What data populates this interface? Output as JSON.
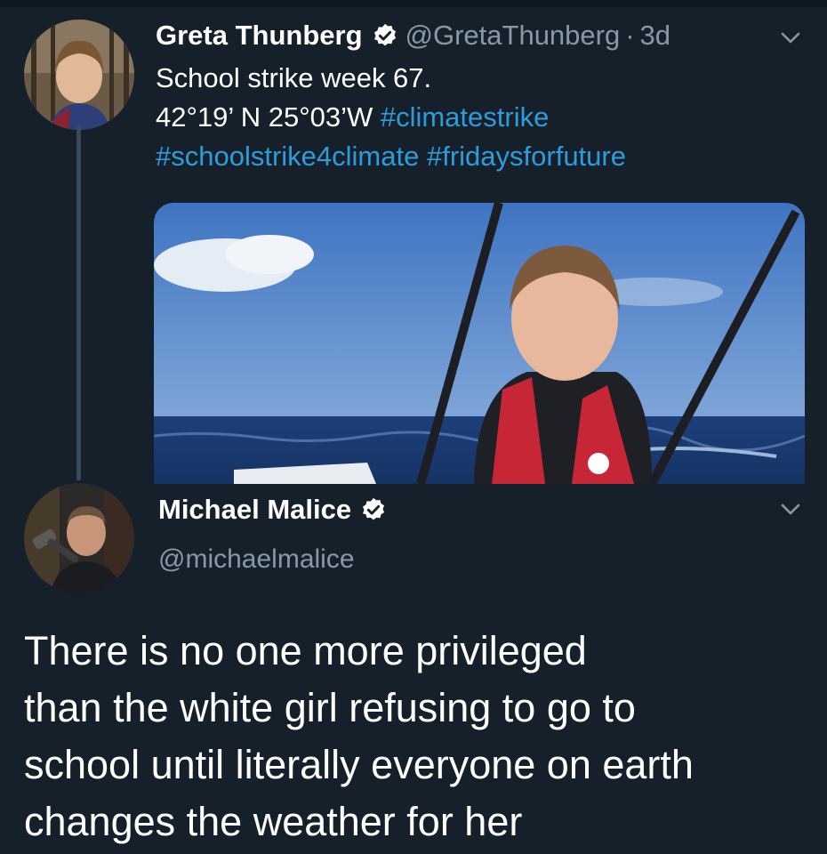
{
  "original_tweet": {
    "display_name": "Greta Thunberg",
    "handle": "@GretaThunberg",
    "separator": "·",
    "timestamp": "3d",
    "text_lines": [
      "School strike week 67.",
      "42°19’ N 25°03’W"
    ],
    "hashtags": {
      "climatestrike": "#climatestrike",
      "schoolstrike4climate": "#schoolstrike4climate",
      "fridaysforfuture": "#fridaysforfuture"
    },
    "media": {
      "description_icon": "photo-on-boat"
    }
  },
  "reply_tweet": {
    "display_name": "Michael Malice",
    "handle": "@michaelmalice",
    "text_lines": [
      "There is no one more privileged",
      "than the white girl refusing to go to",
      "school until literally everyone on earth",
      "changes the weather for her"
    ]
  },
  "icons": {
    "verified": "verified-badge-icon",
    "chevron": "chevron-down-icon"
  },
  "colors": {
    "background": "#15202b",
    "link": "#2d9cdb",
    "secondary_text": "#8899a6",
    "primary_text": "#ffffff"
  }
}
